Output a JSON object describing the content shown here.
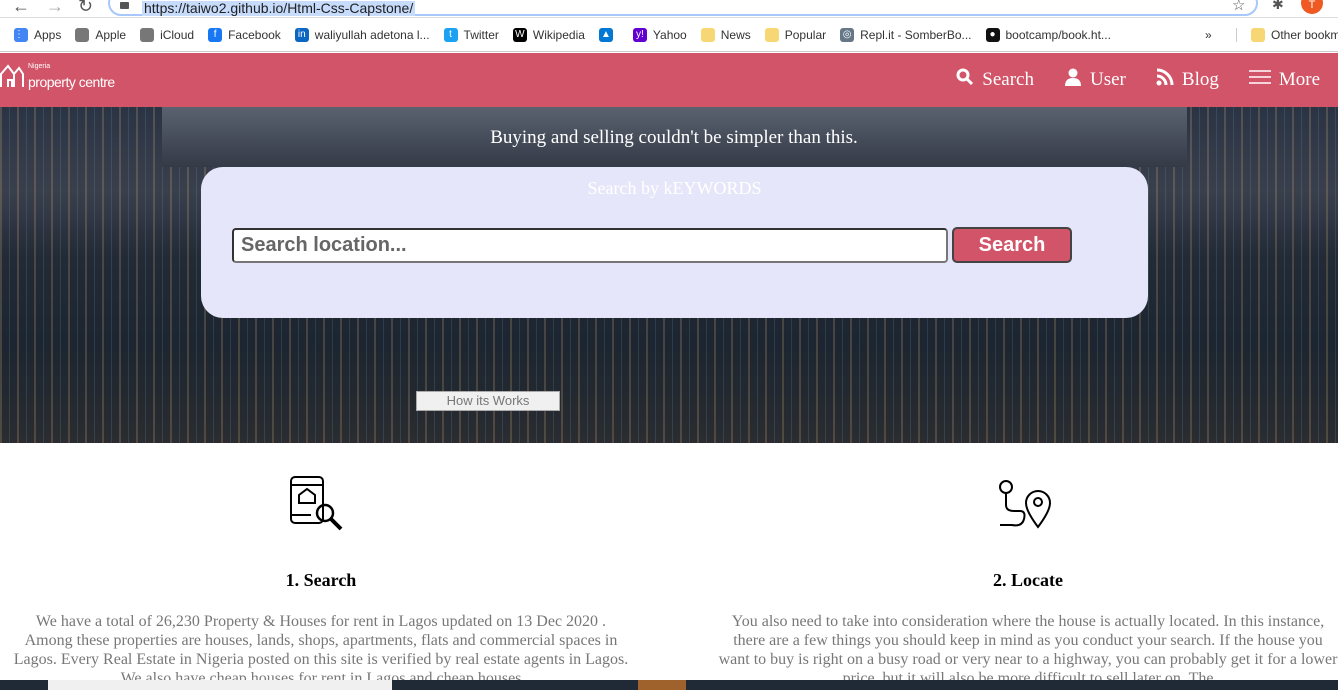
{
  "browser": {
    "url": "https://taiwo2.github.io/Html-Css-Capstone/",
    "profile_initial": "T"
  },
  "bookmarks": [
    {
      "label": "Apps",
      "icon": "apps-grid-icon",
      "color": "#4285f4"
    },
    {
      "label": "Apple",
      "icon": "apple-icon",
      "color": "#777777"
    },
    {
      "label": "iCloud",
      "icon": "apple-icon",
      "color": "#777777"
    },
    {
      "label": "Facebook",
      "icon": "facebook-icon",
      "color": "#1877f2"
    },
    {
      "label": "waliyullah adetona l...",
      "icon": "linkedin-icon",
      "color": "#0a66c2"
    },
    {
      "label": "Twitter",
      "icon": "twitter-icon",
      "color": "#1da1f2"
    },
    {
      "label": "Wikipedia",
      "icon": "wikipedia-icon",
      "color": "#000000"
    },
    {
      "label": "",
      "icon": "azure-icon",
      "color": "#0078d4"
    },
    {
      "label": "Yahoo",
      "icon": "yahoo-icon",
      "color": "#6001d2"
    },
    {
      "label": "News",
      "icon": "folder-icon",
      "color": "#f7d774"
    },
    {
      "label": "Popular",
      "icon": "folder-icon",
      "color": "#f7d774"
    },
    {
      "label": "Repl.it - SomberBo...",
      "icon": "replit-icon",
      "color": "#667788"
    },
    {
      "label": "bootcamp/book.ht...",
      "icon": "github-icon",
      "color": "#111111"
    }
  ],
  "bookmarks_more": "»",
  "other_bookmarks": "Other bookmarks",
  "site": {
    "brand_color": "#d25468",
    "logo_small": "Nigeria",
    "logo_big": "property centre",
    "nav": [
      {
        "label": "Search",
        "icon": "search-icon"
      },
      {
        "label": "User",
        "icon": "user-icon"
      },
      {
        "label": "Blog",
        "icon": "rss-icon"
      },
      {
        "label": "More",
        "icon": "hamburger-icon"
      }
    ],
    "tagline": "Buying and selling couldn't be simpler than this.",
    "search_panel": {
      "title": "Search by kEYWORDS",
      "placeholder": "Search location...",
      "button": "Search"
    },
    "how_button": "How its Works",
    "steps": [
      {
        "title": "1. Search",
        "icon": "phone-house-search-icon",
        "text": "We have a total of 26,230 Property & Houses for rent in Lagos updated on 13 Dec 2020 . Among these properties are houses, lands, shops, apartments, flats and commercial spaces in Lagos. Every Real Estate in Nigeria posted on this site is verified by real estate agents in Lagos. We also have cheap houses for rent in Lagos and cheap houses"
      },
      {
        "title": "2. Locate",
        "icon": "route-pin-icon",
        "text": "You also need to take into consideration where the house is actually located. In this instance, there are a few things you should keep in mind as you conduct your search. If the house you want to buy is right on a busy road or very near to a highway, you can probably get it for a lower price, but it will also be more difficult to sell later on. The"
      }
    ]
  }
}
